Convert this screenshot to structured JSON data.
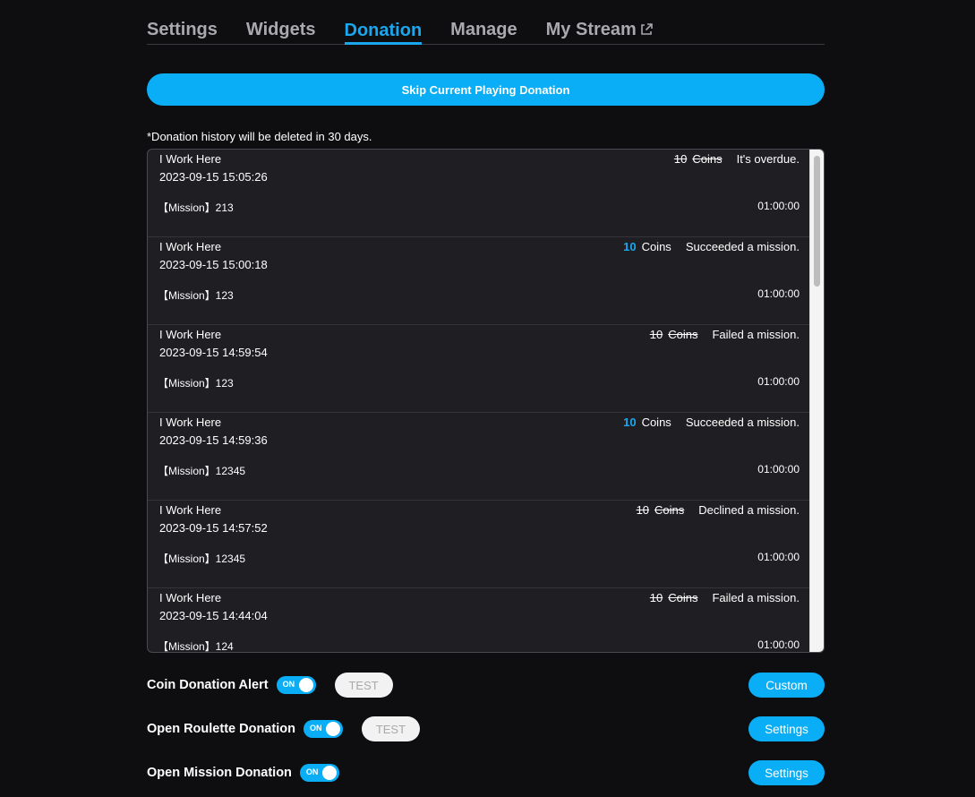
{
  "tabs": [
    {
      "label": "Settings",
      "active": false
    },
    {
      "label": "Widgets",
      "active": false
    },
    {
      "label": "Donation",
      "active": true
    },
    {
      "label": "Manage",
      "active": false
    },
    {
      "label": "My Stream",
      "active": false,
      "icon": "external-link-icon"
    }
  ],
  "skip_button": "Skip Current Playing Donation",
  "notice": "*Donation history will be deleted in 30 days.",
  "history": [
    {
      "name": "I Work Here",
      "time": "2023-09-15 15:05:26",
      "mission": "【Mission】213",
      "duration": "01:00:00",
      "coins": "10",
      "coin_unit": "Coins",
      "struck": true,
      "status": "It's overdue."
    },
    {
      "name": "I Work Here",
      "time": "2023-09-15 15:00:18",
      "mission": "【Mission】123",
      "duration": "01:00:00",
      "coins": "10",
      "coin_unit": "Coins",
      "struck": false,
      "status": "Succeeded a mission."
    },
    {
      "name": "I Work Here",
      "time": "2023-09-15 14:59:54",
      "mission": "【Mission】123",
      "duration": "01:00:00",
      "coins": "10",
      "coin_unit": "Coins",
      "struck": true,
      "status": "Failed a mission."
    },
    {
      "name": "I Work Here",
      "time": "2023-09-15 14:59:36",
      "mission": "【Mission】12345",
      "duration": "01:00:00",
      "coins": "10",
      "coin_unit": "Coins",
      "struck": false,
      "status": "Succeeded a mission."
    },
    {
      "name": "I Work Here",
      "time": "2023-09-15 14:57:52",
      "mission": "【Mission】12345",
      "duration": "01:00:00",
      "coins": "10",
      "coin_unit": "Coins",
      "struck": true,
      "status": "Declined a mission."
    },
    {
      "name": "I Work Here",
      "time": "2023-09-15 14:44:04",
      "mission": "【Mission】124",
      "duration": "01:00:00",
      "coins": "10",
      "coin_unit": "Coins",
      "struck": true,
      "status": "Failed a mission."
    }
  ],
  "settings_rows": [
    {
      "label": "Coin Donation Alert",
      "toggle": "ON",
      "test": "TEST",
      "action": "Custom"
    },
    {
      "label": "Open Roulette Donation",
      "toggle": "ON",
      "test": "TEST",
      "action": "Settings"
    },
    {
      "label": "Open Mission Donation",
      "toggle": "ON",
      "test": null,
      "action": "Settings"
    }
  ],
  "colors": {
    "accent": "#09aef6",
    "background": "#0e0e10",
    "panel": "#1f1f23"
  }
}
